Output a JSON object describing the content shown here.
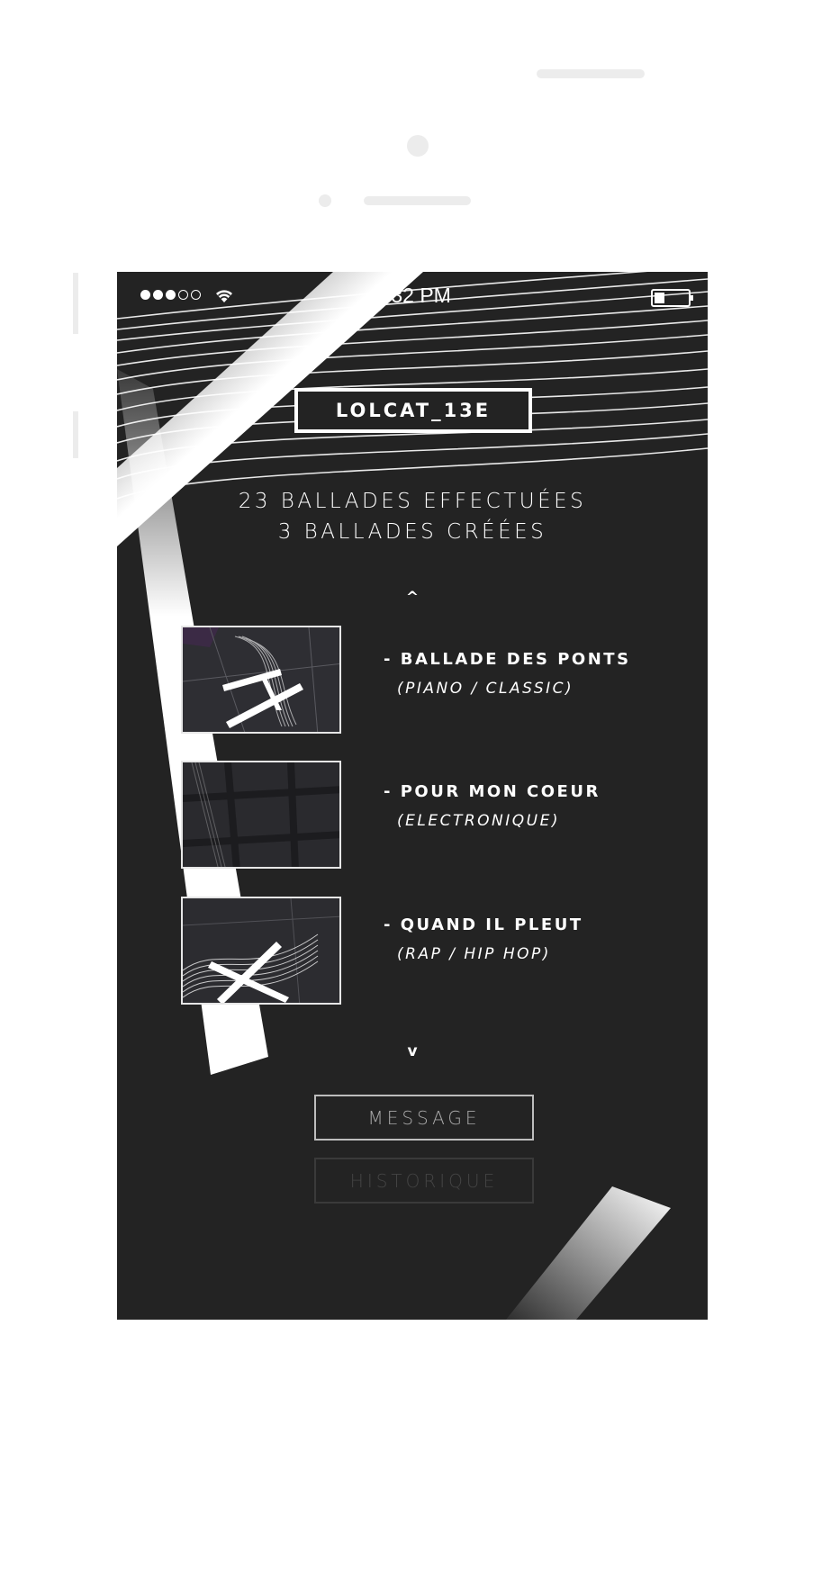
{
  "status_bar": {
    "time": "6:32 PM",
    "signal_full": 3,
    "signal_empty": 2
  },
  "profile": {
    "username": "LOLCAT_13E",
    "stats_done": "23 BALLADES EFFECTUÉES",
    "stats_created": "3 BALLADES CRÉÉES"
  },
  "nav": {
    "up": "^",
    "down": "v"
  },
  "ballades": [
    {
      "title": "- BALLADE DES PONTS",
      "genre": "(PIANO / CLASSIC)"
    },
    {
      "title": "- POUR MON COEUR",
      "genre": "(ELECTRONIQUE)"
    },
    {
      "title": "- QUAND IL PLEUT",
      "genre": "(RAP  / HIP HOP)"
    }
  ],
  "buttons": {
    "message": "MESSAGE",
    "historique": "HISTORIQUE"
  },
  "colors": {
    "screen_bg": "#232323",
    "text": "#ffffff",
    "accent_band": "#ffffff"
  },
  "icons": [
    "signal-icon",
    "wifi-icon",
    "battery-icon",
    "chevron-up-icon",
    "chevron-down-icon"
  ]
}
